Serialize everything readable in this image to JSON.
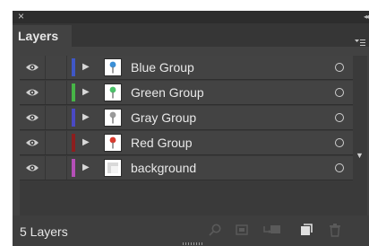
{
  "window": {
    "close_glyph": "×",
    "collapse_glyph": "◂◂"
  },
  "tab": {
    "label": "Layers"
  },
  "panel_menu_icon": "panel-menu-icon",
  "layers": [
    {
      "name": "Blue Group",
      "color": "#3f57c6",
      "thumb_icon": "blue-pin",
      "thumb_color": "#3b8fd6"
    },
    {
      "name": "Green Group",
      "color": "#47b547",
      "thumb_icon": "green-pin",
      "thumb_color": "#4cc26a"
    },
    {
      "name": "Gray Group",
      "color": "#4a49c4",
      "thumb_icon": "gray-pin",
      "thumb_color": "#9a9a9a"
    },
    {
      "name": "Red Group",
      "color": "#8c1e1e",
      "thumb_icon": "red-pin",
      "thumb_color": "#d93b2f"
    },
    {
      "name": "background",
      "color": "#b54fb7",
      "thumb_icon": "background-thumb",
      "thumb_color": "#d9d9d9"
    }
  ],
  "footer": {
    "count": "5 Layers"
  }
}
